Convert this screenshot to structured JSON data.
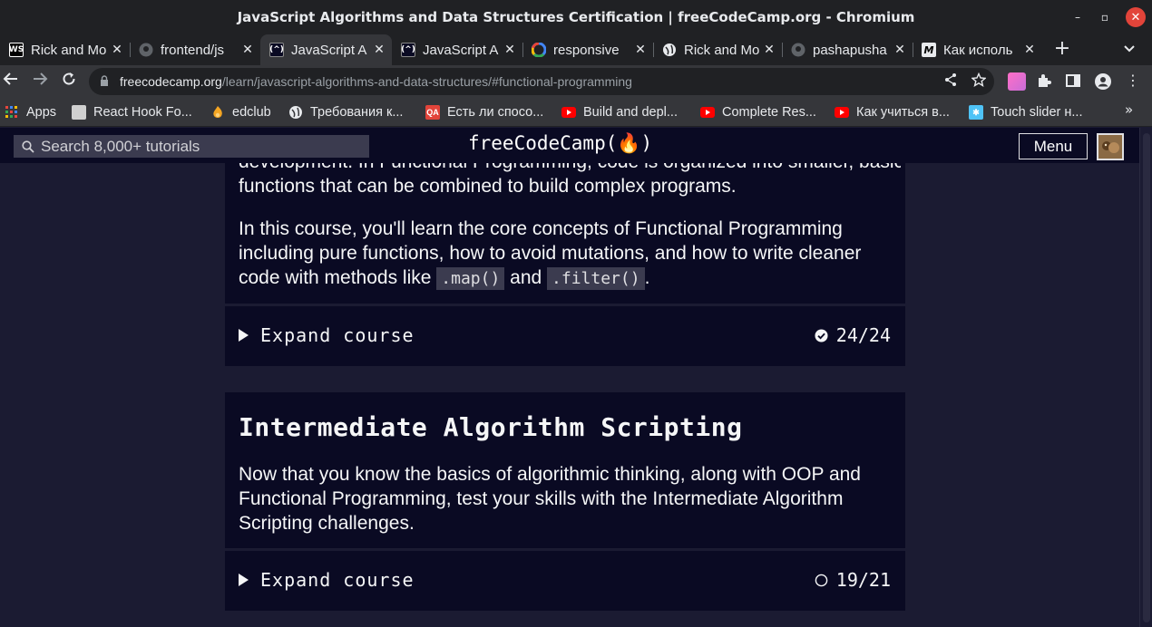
{
  "window": {
    "title": "JavaScript Algorithms and Data Structures Certification | freeCodeCamp.org - Chromium",
    "minimize": "–",
    "maximize": "▫",
    "close": "✕"
  },
  "tabs": [
    {
      "label": "Rick and Mo",
      "icon": "webstorm-icon",
      "active": false
    },
    {
      "label": "frontend/js",
      "icon": "github-icon",
      "active": false
    },
    {
      "label": "JavaScript A",
      "icon": "freecodecamp-icon",
      "active": true
    },
    {
      "label": "JavaScript A",
      "icon": "freecodecamp-icon",
      "active": false
    },
    {
      "label": "responsive",
      "icon": "google-icon",
      "active": false
    },
    {
      "label": "Rick and Mo",
      "icon": "globe-icon",
      "active": false
    },
    {
      "label": "pashapusha",
      "icon": "github-icon",
      "active": false
    },
    {
      "label": "Как исполь",
      "icon": "medium-icon",
      "active": false
    }
  ],
  "tab_close": "✕",
  "new_tab": "+",
  "address": {
    "host": "freecodecamp.org",
    "path": "/learn/javascript-algorithms-and-data-structures/#functional-programming"
  },
  "bookmarks": [
    {
      "label": "Apps",
      "icon": "apps-grid-icon",
      "color": "#e8453c"
    },
    {
      "label": "React Hook Fo...",
      "icon": "react-hook-form-icon",
      "color": "#ec5990"
    },
    {
      "label": "edclub",
      "icon": "edclub-icon",
      "color": "#f5a623"
    },
    {
      "label": "Требования к...",
      "icon": "globe-icon",
      "color": "#e8eaed"
    },
    {
      "label": "Есть ли спосо...",
      "icon": "qa-icon",
      "color": "#e2443a"
    },
    {
      "label": "Build and depl...",
      "icon": "youtube-icon",
      "color": "#ff0000"
    },
    {
      "label": "Complete Res...",
      "icon": "youtube-icon",
      "color": "#ff0000"
    },
    {
      "label": "Как учиться в...",
      "icon": "youtube-icon",
      "color": "#ff0000"
    },
    {
      "label": "Touch slider н...",
      "icon": "slider-icon",
      "color": "#4fc3f7"
    }
  ],
  "bookmarks_more": "»",
  "fcc": {
    "search_placeholder": "Search 8,000+ tutorials",
    "logo": "freeCodeCamp(🔥)",
    "menu": "Menu"
  },
  "blocks": {
    "functional": {
      "partial_line": "development. In Functional Programming, code is organized into smaller, basic",
      "line2": "functions that can be combined to build complex programs.",
      "para2_a": "In this course, you'll learn the core concepts of Functional Programming including pure functions, how to avoid mutations, and how to write cleaner code with methods like ",
      "code1": ".map()",
      "para2_b": " and ",
      "code2": ".filter()",
      "para2_c": ".",
      "expand": "Expand course",
      "progress": "24/24",
      "complete": true
    },
    "intermediate": {
      "title": "Intermediate Algorithm Scripting",
      "description": "Now that you know the basics of algorithmic thinking, along with OOP and Functional Programming, test your skills with the Intermediate Algorithm Scripting challenges.",
      "expand": "Expand course",
      "progress": "19/21",
      "complete": false
    }
  }
}
